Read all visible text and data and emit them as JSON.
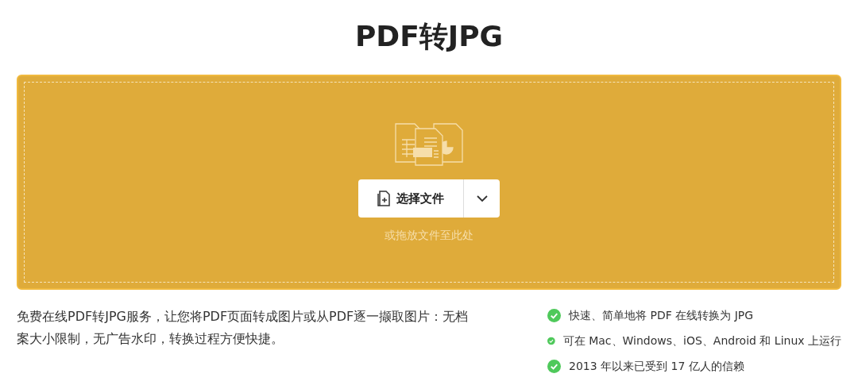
{
  "title": "PDF转JPG",
  "upload": {
    "button": "选择文件",
    "hint": "或拖放文件至此处"
  },
  "description": "免费在线PDF转JPG服务，让您将PDF页面转成图片或从PDF逐一撷取图片：无档案大小限制，无广告水印，转换过程方便快捷。",
  "features": [
    "快速、简单地将 PDF 在线转换为 JPG",
    "可在 Mac、Windows、iOS、Android 和 Linux 上运行",
    "2013 年以来已受到 17 亿人的信赖"
  ]
}
